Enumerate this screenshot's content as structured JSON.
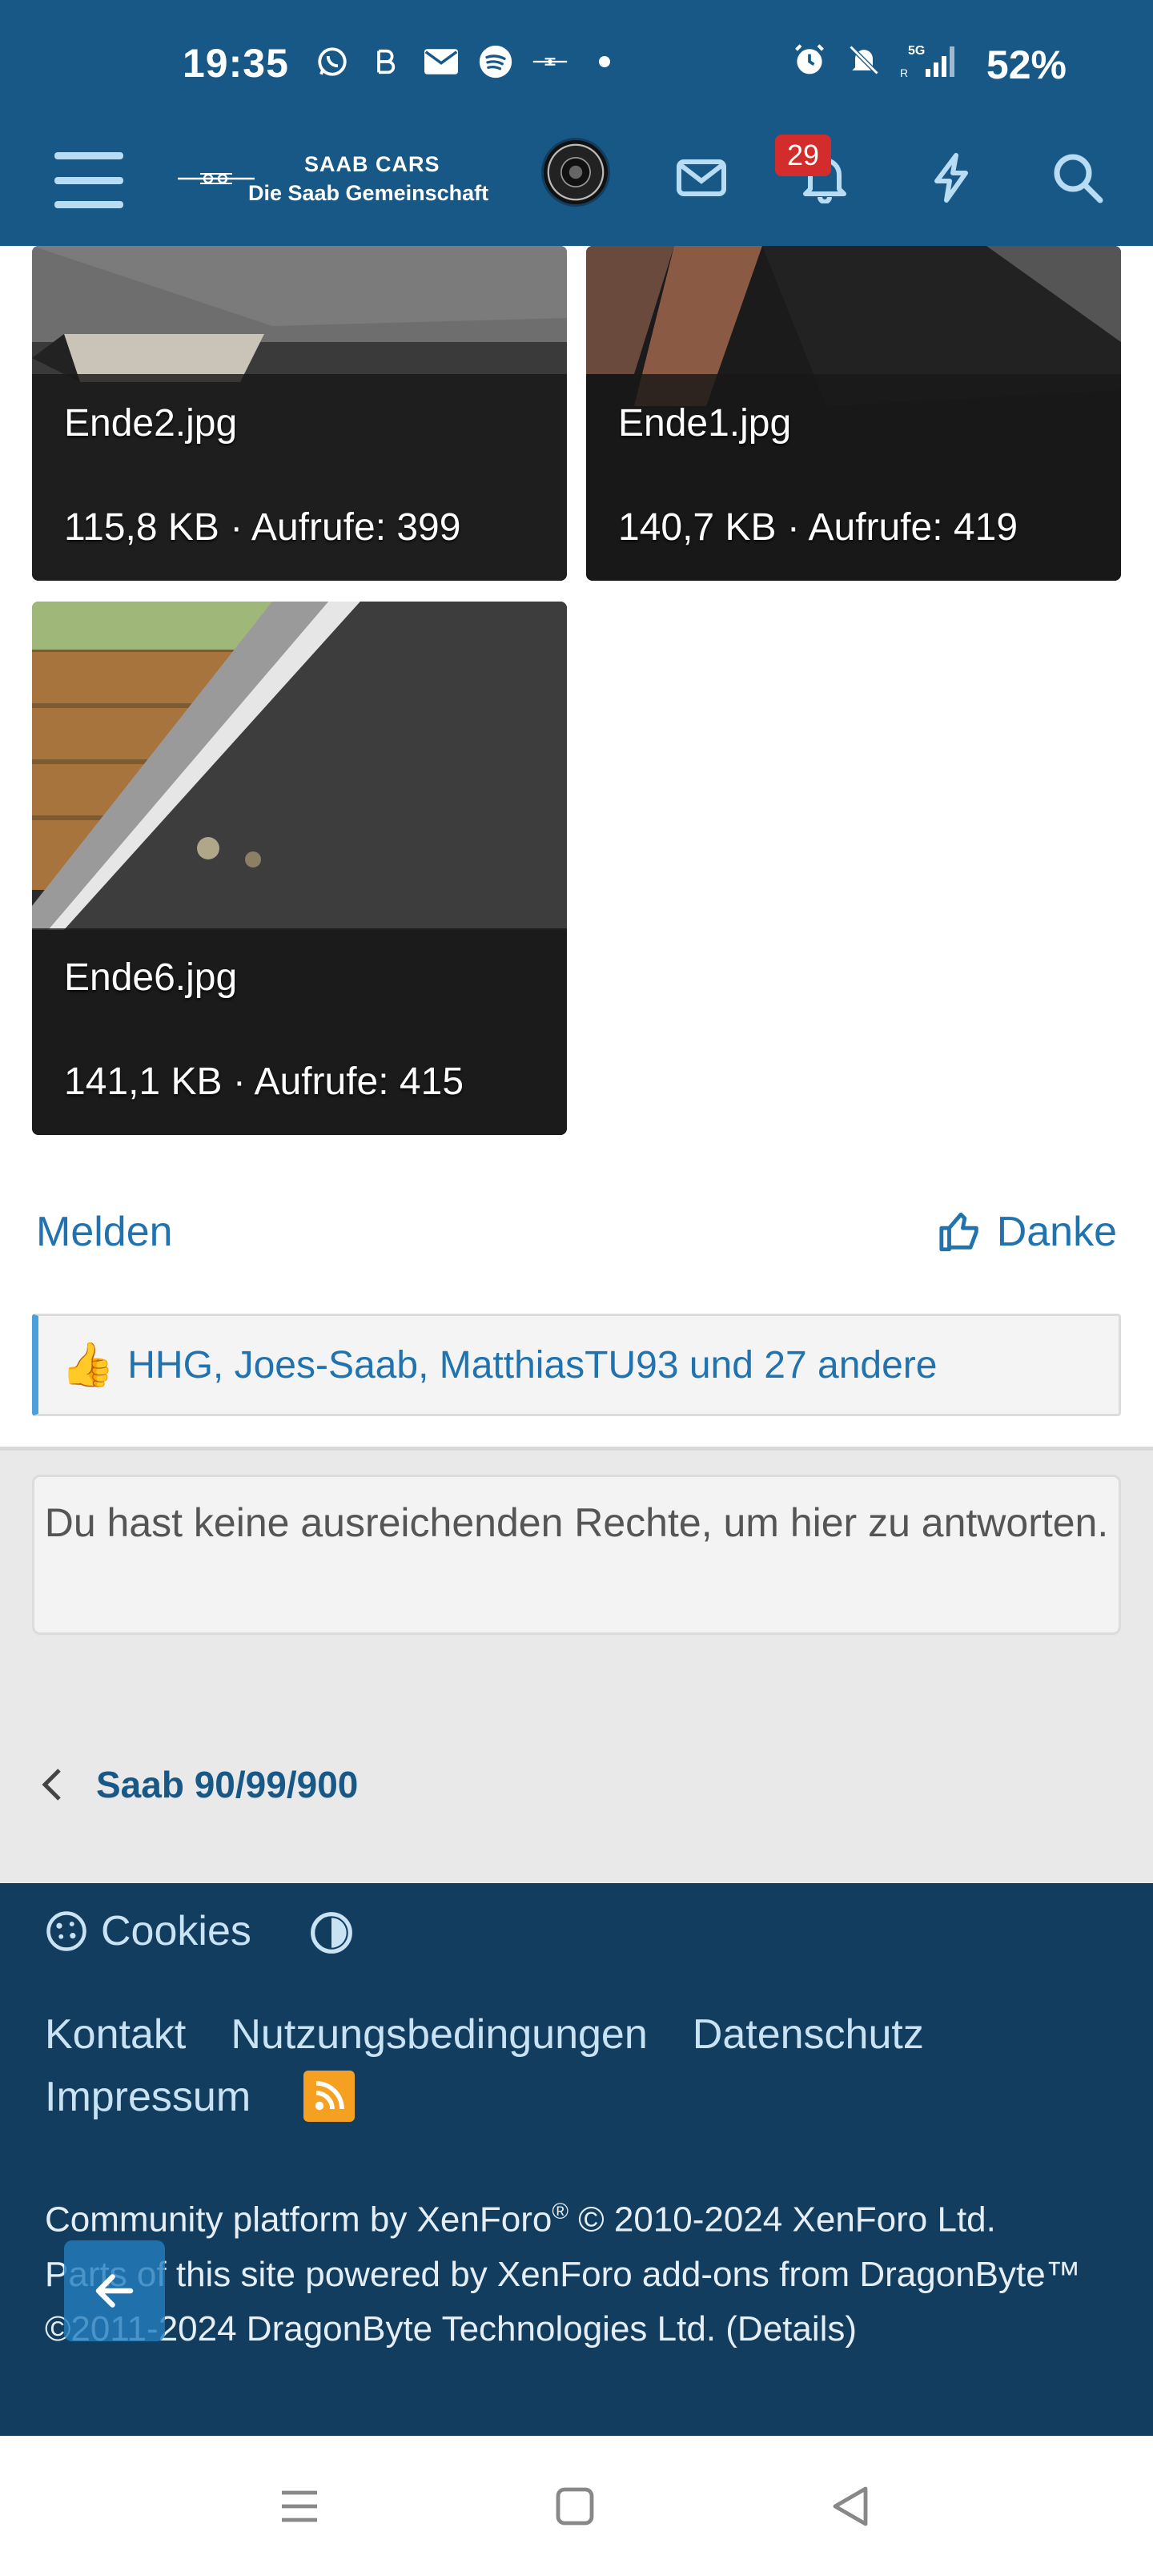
{
  "status_bar": {
    "time": "19:35",
    "battery": "52%",
    "icons_left": [
      "whatsapp-icon",
      "signal-app-icon",
      "mail-icon",
      "spotify-icon",
      "saab-icon",
      "dot-icon"
    ],
    "icons_right": [
      "alarm-icon",
      "mute-icon",
      "5g-signal-icon"
    ]
  },
  "header": {
    "logo_line1": "SAAB CARS",
    "logo_line2": "Die Saab Gemeinschaft",
    "notification_count": "29",
    "colors": {
      "bar": "#185886",
      "badge": "#d22c2c"
    }
  },
  "attachments": [
    {
      "name": "Ende2.jpg",
      "meta": "115,8 KB · Aufrufe: 399"
    },
    {
      "name": "Ende1.jpg",
      "meta": "140,7 KB · Aufrufe: 419"
    },
    {
      "name": "Ende6.jpg",
      "meta": "141,1 KB · Aufrufe: 415"
    }
  ],
  "post_actions": {
    "report": "Melden",
    "thanks": "Danke"
  },
  "likes": {
    "text": "HHG, Joes-Saab, MatthiasTU93 und 27 andere"
  },
  "no_permission": "Du hast keine ausreichenden Rechte, um hier zu antworten.",
  "breadcrumb": {
    "label": "Saab 90/99/900"
  },
  "footer": {
    "cookies": "Cookies",
    "links": [
      "Kontakt",
      "Nutzungsbedingungen",
      "Datenschutz",
      "Impressum"
    ],
    "copyright_line1_a": "Community platform by XenForo",
    "copyright_line1_b": " © 2010-2024 XenForo Ltd.",
    "copyright_line2": "Parts of this site powered by XenForo add-ons from DragonByte™ ©2011-2024 DragonByte Technologies Ltd. (Details)",
    "colors": {
      "background": "#123d5e",
      "rss": "#f5a021"
    }
  }
}
